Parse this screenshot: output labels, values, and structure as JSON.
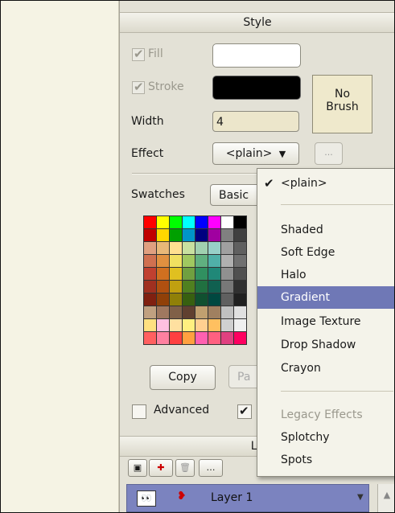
{
  "style_panel": {
    "title": "Style",
    "fill_label": "Fill",
    "stroke_label": "Stroke",
    "width_label": "Width",
    "width_value": "4",
    "effect_label": "Effect",
    "effect_value": "<plain>",
    "effect_more": "...",
    "no_brush_line1": "No",
    "no_brush_line2": "Brush",
    "swatches_label": "Swatches",
    "swatches_set": "Basic",
    "copy_label": "Copy",
    "paste_label": "Pa",
    "advanced_label": "Advanced",
    "swatch_colors": [
      "#ff0000",
      "#ffff00",
      "#00ff00",
      "#00ffff",
      "#0000ff",
      "#ff00ff",
      "#ffffff",
      "#000000",
      "#c00000",
      "#ffd700",
      "#00a000",
      "#0095c8",
      "#000080",
      "#a000a0",
      "#808080",
      "#404040",
      "#e0a080",
      "#e8b878",
      "#ffe090",
      "#c8e0a0",
      "#a0d0b0",
      "#98d0c8",
      "#a0a0a0",
      "#606060",
      "#d07050",
      "#e09040",
      "#f0e060",
      "#a0c860",
      "#60b080",
      "#50b0a8",
      "#b0b0b0",
      "#707070",
      "#c04030",
      "#d07020",
      "#e0c020",
      "#70a040",
      "#309060",
      "#208878",
      "#909090",
      "#505050",
      "#a03020",
      "#b05010",
      "#c0a010",
      "#508020",
      "#207040",
      "#106050",
      "#787878",
      "#303030",
      "#802010",
      "#904008",
      "#908008",
      "#386010",
      "#105030",
      "#004840",
      "#606060",
      "#202020",
      "#c0a080",
      "#a07860",
      "#806048",
      "#604030",
      "#c0a070",
      "#a08060",
      "#c0c0c0",
      "#e0e0e0",
      "#ffe080",
      "#ffc0e0",
      "#ffe0a0",
      "#fff080",
      "#ffd090",
      "#ffc060",
      "#d0d0d0",
      "#f0f0f0",
      "#ff6060",
      "#ff80a0",
      "#ff4040",
      "#ffa040",
      "#ff60b0",
      "#ff6080",
      "#e04080",
      "#ff0060"
    ]
  },
  "effect_menu": {
    "items": [
      {
        "label": "<plain>",
        "checked": true
      },
      {
        "label": "Shaded"
      },
      {
        "label": "Soft Edge"
      },
      {
        "label": "Halo"
      },
      {
        "label": "Gradient",
        "selected": true
      },
      {
        "label": "Image Texture"
      },
      {
        "label": "Drop Shadow"
      },
      {
        "label": "Crayon"
      },
      {
        "label": "Legacy Effects",
        "disabled": true
      },
      {
        "label": "Splotchy"
      },
      {
        "label": "Spots"
      }
    ]
  },
  "layers_panel": {
    "title": "La",
    "layer_name": "Layer 1"
  }
}
